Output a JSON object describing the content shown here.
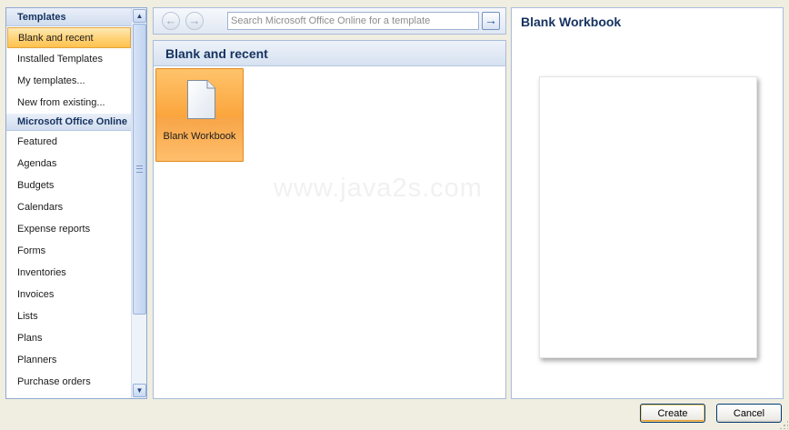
{
  "sidebar": {
    "groups": [
      {
        "header": "Templates",
        "items": [
          "Blank and recent",
          "Installed Templates",
          "My templates...",
          "New from existing..."
        ]
      },
      {
        "header": "Microsoft Office Online",
        "items": [
          "Featured",
          "Agendas",
          "Budgets",
          "Calendars",
          "Expense reports",
          "Forms",
          "Inventories",
          "Invoices",
          "Lists",
          "Plans",
          "Planners",
          "Purchase orders"
        ]
      }
    ],
    "selected": "Blank and recent"
  },
  "toolbar": {
    "back_icon": "back-arrow-icon",
    "forward_icon": "forward-arrow-icon",
    "search_placeholder": "Search Microsoft Office Online for a template",
    "search_value": "",
    "go_icon": "go-arrow-icon"
  },
  "gallery": {
    "header": "Blank and recent",
    "tiles": [
      {
        "label": "Blank Workbook",
        "icon": "blank-document-icon",
        "selected": true
      }
    ],
    "watermark": "www.java2s.com"
  },
  "preview": {
    "title": "Blank Workbook"
  },
  "buttons": {
    "create": "Create",
    "cancel": "Cancel"
  },
  "colors": {
    "accent_selection": "#ffd37a",
    "header_text": "#15325f",
    "border": "#a9bcd9"
  }
}
